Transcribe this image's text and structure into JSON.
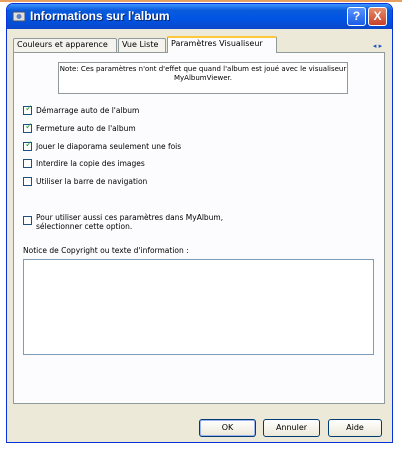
{
  "window": {
    "title": "Informations sur l'album",
    "help_label": "?",
    "close_label": "X"
  },
  "tabs": [
    {
      "label": "Couleurs et apparence",
      "active": false
    },
    {
      "label": "Vue Liste",
      "active": false
    },
    {
      "label": "Paramètres Visualiseur",
      "active": true
    }
  ],
  "tab_scroll": "◂ ▸",
  "note": "Note: Ces paramètres n'ont d'effet que quand l'album est joué avec le visualiseur MyAlbumViewer.",
  "options": [
    {
      "label": "Démarrage auto de l'album",
      "checked": true
    },
    {
      "label": "Fermeture auto de l'album",
      "checked": true
    },
    {
      "label": "Jouer le diaporama seulement une fois",
      "checked": true
    },
    {
      "label": "Interdire la copie des images",
      "checked": false
    },
    {
      "label": "Utiliser la barre de navigation",
      "checked": false
    }
  ],
  "myalbum_option": {
    "label": "Pour utiliser aussi ces paramètres dans MyAlbum, sélectionner cette option.",
    "checked": false
  },
  "copyright": {
    "label": "Notice de Copyright ou texte d'information :",
    "value": ""
  },
  "buttons": {
    "ok": "OK",
    "cancel": "Annuler",
    "help": "Aide"
  },
  "colors": {
    "titlebar": "#0054e3",
    "active_tab_accent": "#ffc83c",
    "checkmark": "#21a121"
  }
}
